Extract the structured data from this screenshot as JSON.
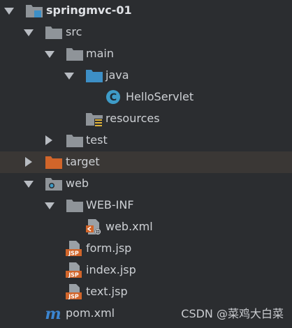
{
  "project": {
    "name": "springmvc-01"
  },
  "tree": {
    "src": "src",
    "main": "main",
    "java": "java",
    "hello_servlet": "HelloServlet",
    "class_badge": "C",
    "resources": "resources",
    "test": "test",
    "target": "target",
    "web": "web",
    "web_inf": "WEB-INF",
    "web_xml": "web.xml",
    "form_jsp": "form.jsp",
    "index_jsp": "index.jsp",
    "text_jsp": "text.jsp",
    "pom_xml": "pom.xml",
    "jsp_badge": "JSP",
    "pom_badge": "m"
  },
  "watermark": "CSDN @菜鸡大白菜",
  "colors": {
    "background": "#2b2d30",
    "folder": "#8f9499",
    "source_folder": "#3d8fc6",
    "excluded_folder": "#d1652a",
    "jsp": "#d1652a",
    "class_badge": "#3e9cc8",
    "pom": "#3b85d0"
  }
}
